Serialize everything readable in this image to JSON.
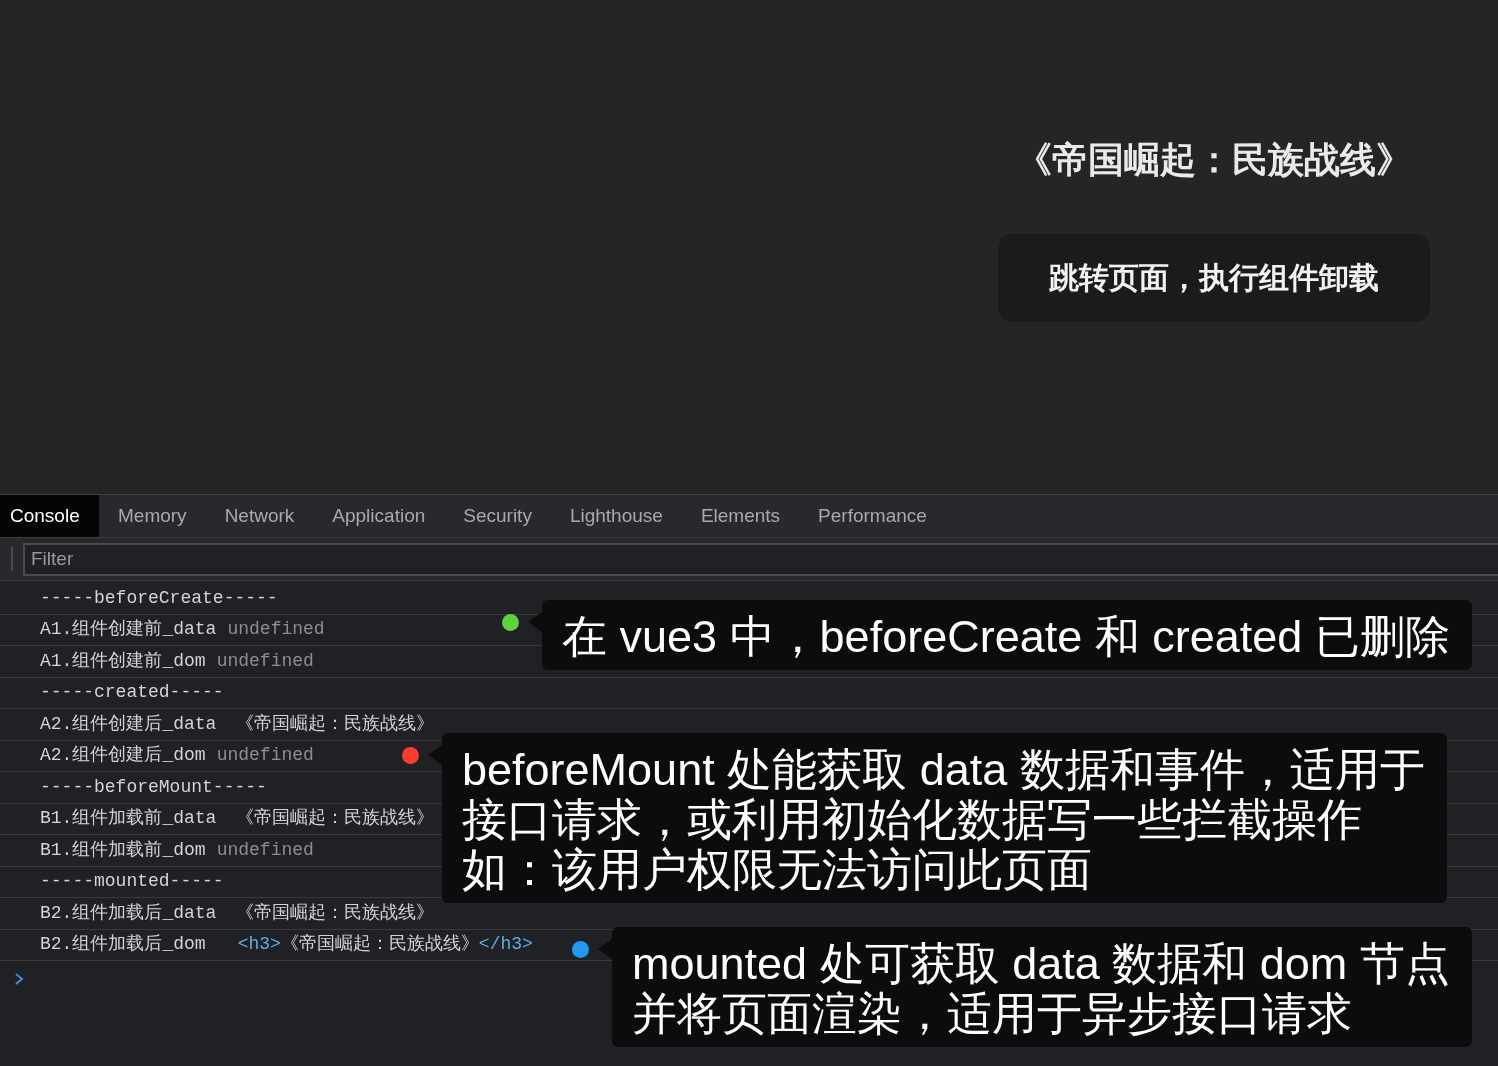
{
  "page": {
    "heading": "《帝国崛起：民族战线》",
    "button": "跳转页面，执行组件卸载"
  },
  "devtools": {
    "tabs": [
      {
        "label": "Console",
        "selected": true
      },
      {
        "label": "Memory",
        "selected": false
      },
      {
        "label": "Network",
        "selected": false
      },
      {
        "label": "Application",
        "selected": false
      },
      {
        "label": "Security",
        "selected": false
      },
      {
        "label": "Lighthouse",
        "selected": false
      },
      {
        "label": "Elements",
        "selected": false
      },
      {
        "label": "Performance",
        "selected": false
      }
    ],
    "filter": {
      "placeholder": "Filter"
    },
    "logs": [
      {
        "kind": "divider",
        "text": "-----beforeCreate-----"
      },
      {
        "kind": "log",
        "label": "A1.组件创建前_data",
        "value": {
          "kind": "undefined",
          "text": "undefined"
        }
      },
      {
        "kind": "log",
        "label": "A1.组件创建前_dom",
        "value": {
          "kind": "undefined",
          "text": "undefined"
        }
      },
      {
        "kind": "divider",
        "text": "-----created-----"
      },
      {
        "kind": "log",
        "label": "A2.组件创建后_data",
        "value": {
          "kind": "string",
          "text": "《帝国崛起：民族战线》"
        }
      },
      {
        "kind": "log",
        "label": "A2.组件创建后_dom",
        "value": {
          "kind": "undefined",
          "text": "undefined"
        }
      },
      {
        "kind": "divider",
        "text": "-----beforeMount-----"
      },
      {
        "kind": "log",
        "label": "B1.组件加载前_data",
        "value": {
          "kind": "string",
          "text": "《帝国崛起：民族战线》"
        }
      },
      {
        "kind": "log",
        "label": "B1.组件加载前_dom",
        "value": {
          "kind": "undefined",
          "text": "undefined"
        }
      },
      {
        "kind": "divider",
        "text": "-----mounted-----"
      },
      {
        "kind": "log",
        "label": "B2.组件加载后_data",
        "value": {
          "kind": "string",
          "text": "《帝国崛起：民族战线》"
        }
      },
      {
        "kind": "log",
        "label": "B2.组件加载后_dom",
        "value": {
          "kind": "element",
          "open_tag": "<h3>",
          "text": "《帝国崛起：民族战线》",
          "close_tag": "</h3>"
        }
      }
    ]
  },
  "annotations": [
    {
      "color": "#5ed33c",
      "lines": [
        "在 vue3 中，beforeCreate 和 created 已删除"
      ]
    },
    {
      "color": "#ff3b30",
      "lines": [
        "beforeMount 处能获取 data 数据和事件，适用于",
        "接口请求，或利用初始化数据写一些拦截操作",
        "如：该用户权限无法访问此页面"
      ]
    },
    {
      "color": "#1e9bf0",
      "lines": [
        "mounted 处可获取 data 数据和 dom 节点",
        "并将页面渲染，适用于异步接口请求"
      ]
    }
  ]
}
